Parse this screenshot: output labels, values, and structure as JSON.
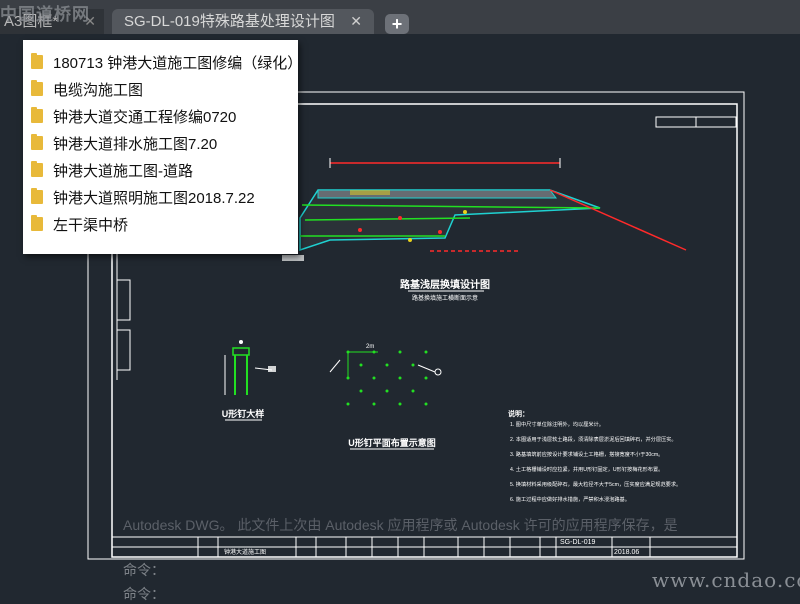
{
  "tabs": {
    "inactive": "A3图框*",
    "active": "SG-DL-019特殊路基处理设计图",
    "close_glyph": "✕",
    "new_glyph": "+"
  },
  "watermark_top": "中国道桥网",
  "popup_items": [
    "180713 钟港大道施工图修编（绿化）",
    "电缆沟施工图",
    "钟港大道交通工程修编0720",
    "钟港大道排水施工图7.20",
    "钟港大道施工图-道路",
    "钟港大道照明施工图2018.7.22",
    "左干渠中桥"
  ],
  "drawing": {
    "section_title": "路基浅层换填设计图",
    "section_subtitle": "路基换填施工横断面示意",
    "u_nail_title": "U形钉大样",
    "u_nail_plan_title": "U形钉平面布置示意图",
    "dim_label": "2m",
    "note_title": "说明：",
    "notes": [
      "1. 图中尺寸单位除注明外，均以厘米计。",
      "2. 本图适用于浅层软土路段，须清除表层淤泥后回填碎石，并分层压实。",
      "3. 路基填筑前应按设计要求铺设土工格栅，搭接宽度不小于30cm。",
      "4. 土工格栅铺设时应拉紧，并用U形钉固定，U形钉按梅花形布置。",
      "5. 换填材料采用级配碎石，最大粒径不大于5cm，压实度应满足规范要求。",
      "6. 施工过程中应做好排水措施，严禁积水浸泡路基。"
    ],
    "title_block": {
      "date": "2018.06",
      "sheet": "SG-DL-019",
      "project": "钟港大道施工图"
    }
  },
  "autodesk_message": "Autodesk DWG。 此文件上次由 Autodesk 应用程序或 Autodesk 许可的应用程序保存，是",
  "command_lines": [
    "命令：",
    "命令："
  ],
  "site_watermark": "www.cndao.com",
  "colors": {
    "background": "#212830",
    "frame": "#ffffff",
    "red": "#ff2a2a",
    "green": "#22e022",
    "cyan": "#1fd1d1",
    "yellow": "#e8d21a",
    "folder": "#e8b93a"
  }
}
